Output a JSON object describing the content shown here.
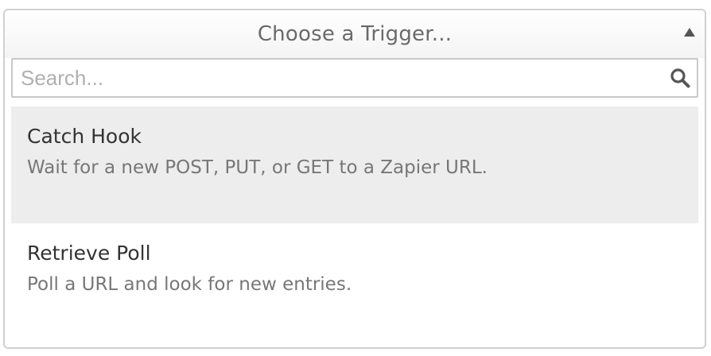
{
  "dropdown": {
    "title": "Choose a Trigger...",
    "caret_icon": "caret-up-icon"
  },
  "search": {
    "placeholder": "Search...",
    "value": "",
    "icon": "search-icon"
  },
  "results": [
    {
      "title": "Catch Hook",
      "description": "Wait for a new POST, PUT, or GET to a Zapier URL.",
      "highlighted": true
    },
    {
      "title": "Retrieve Poll",
      "description": "Poll a URL and look for new entries.",
      "highlighted": false
    }
  ],
  "colors": {
    "highlight_bg": "#ededed",
    "border": "#d0d0d0"
  }
}
